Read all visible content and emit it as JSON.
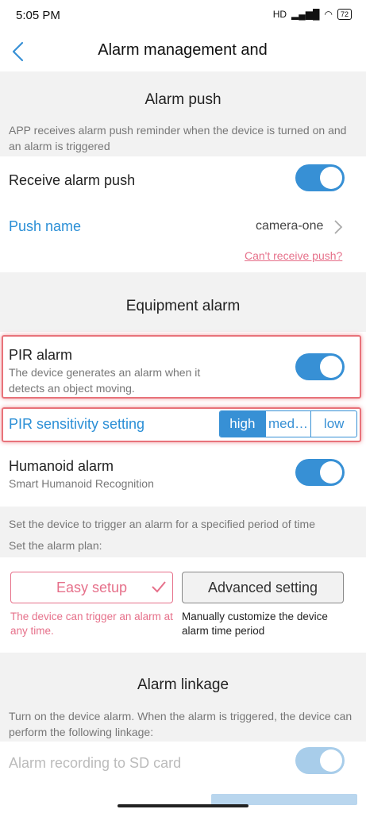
{
  "status": {
    "time": "5:05 PM",
    "network": "HD",
    "battery": "72"
  },
  "header": {
    "title": "Alarm management and"
  },
  "alarm_push": {
    "heading": "Alarm push",
    "desc": "APP receives alarm push reminder when the device is turned on and an alarm is triggered",
    "receive_label": "Receive alarm push",
    "receive_on": true,
    "push_name_label": "Push name",
    "push_name_value": "camera-one",
    "cant_receive": "Can't receive push?"
  },
  "equipment": {
    "heading": "Equipment alarm",
    "pir_label": "PIR alarm",
    "pir_desc": "The device generates an alarm when it detects an object moving.",
    "pir_on": true,
    "sens_label": "PIR sensitivity setting",
    "sens_options": [
      "high",
      "med…",
      "low"
    ],
    "sens_selected": "high",
    "humanoid_label": "Humanoid alarm",
    "humanoid_desc": "Smart Humanoid Recognition",
    "humanoid_on": true
  },
  "plan": {
    "desc1": "Set the device to trigger an alarm for a specified period of time",
    "desc2": "Set the alarm plan:",
    "easy_label": "Easy setup",
    "easy_caption": "The device can trigger an alarm at any time.",
    "adv_label": "Advanced setting",
    "adv_caption": "Manually customize the device alarm time period"
  },
  "linkage": {
    "heading": "Alarm linkage",
    "desc": "Turn on the device alarm. When the alarm is triggered, the device can perform the following linkage:",
    "sd_label": "Alarm recording to SD card",
    "sd_on": true
  },
  "colors": {
    "accent": "#3790d5",
    "highlight": "#e8727a",
    "pink": "#e6708a"
  }
}
